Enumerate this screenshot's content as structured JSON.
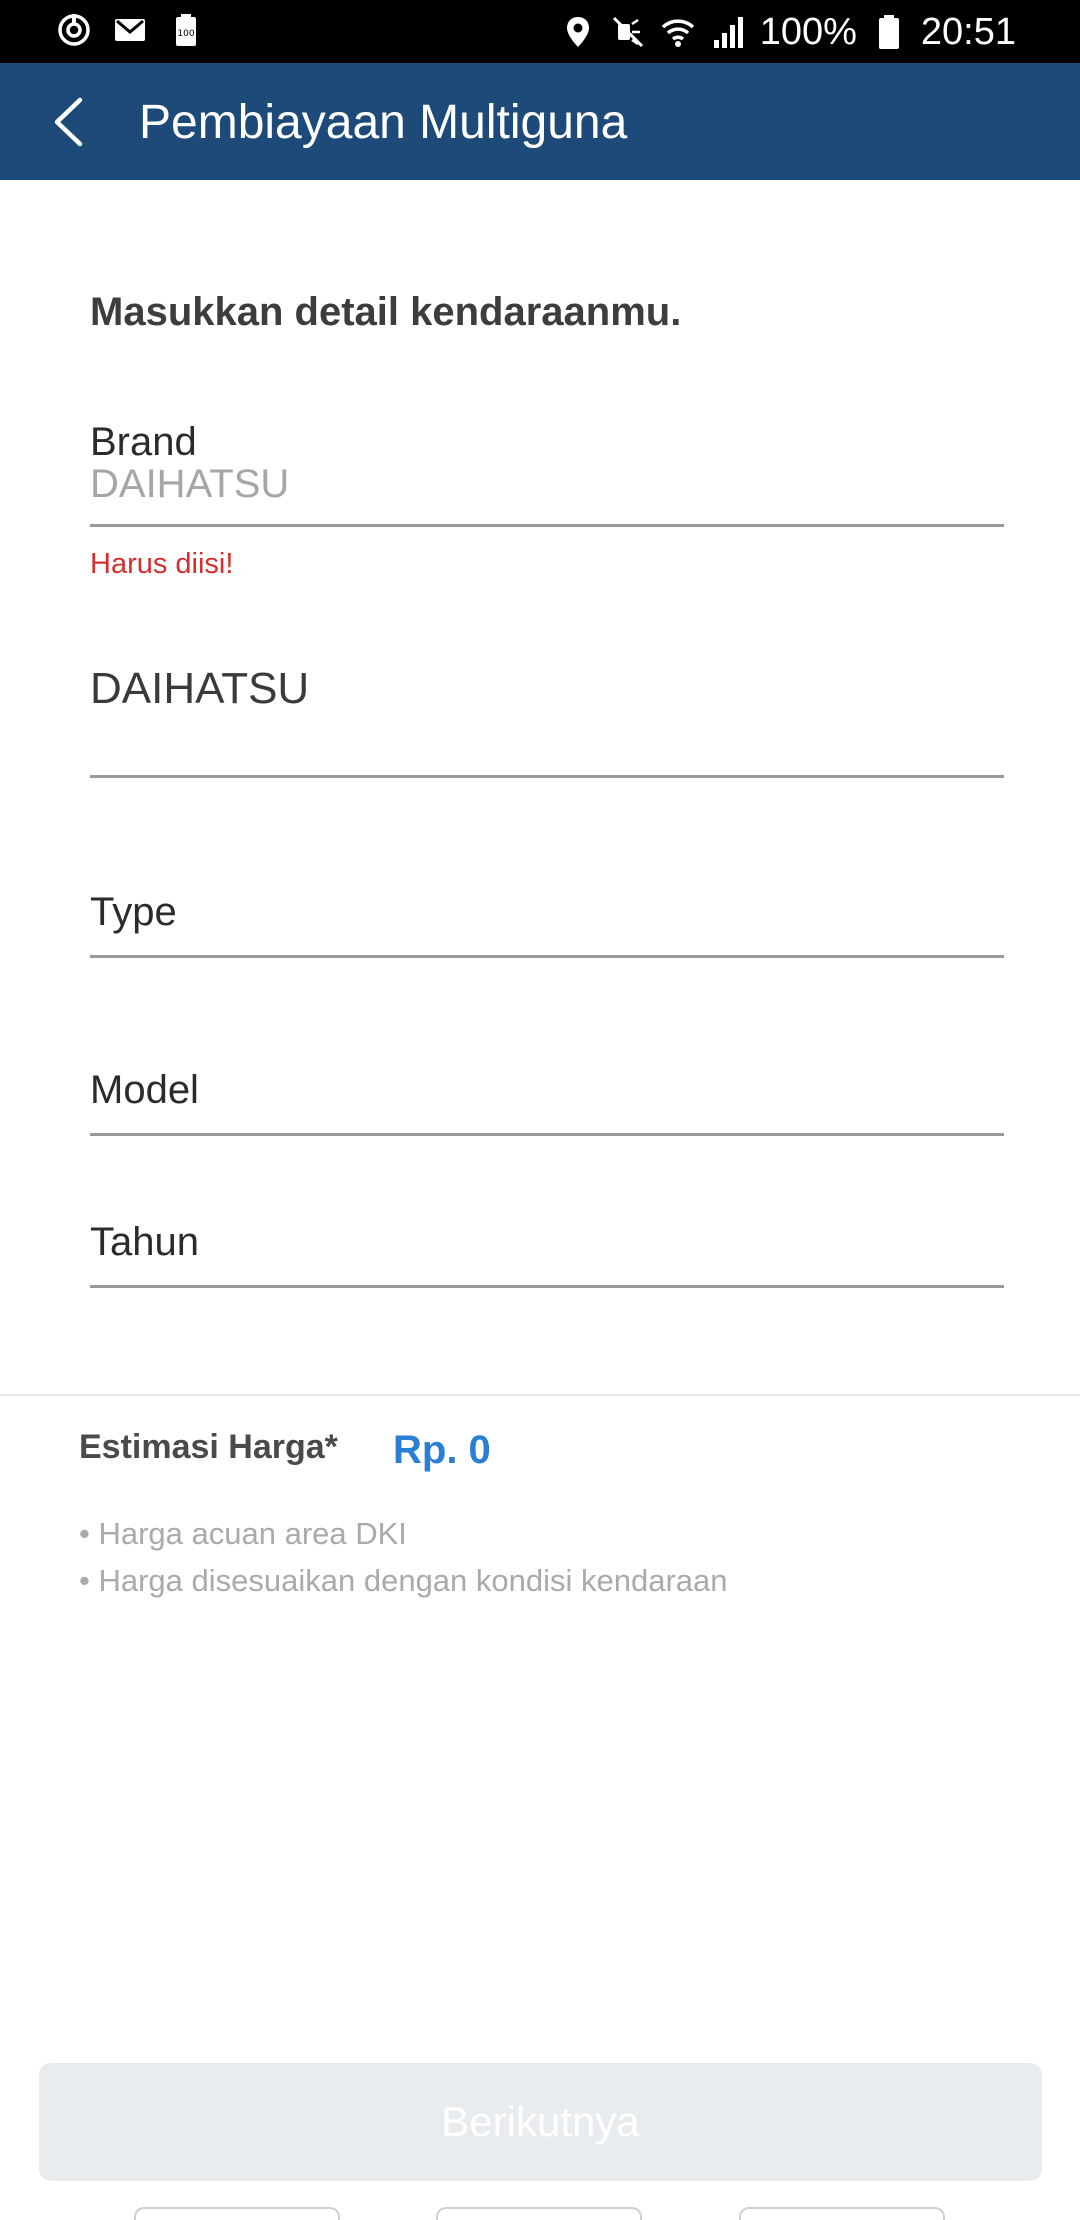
{
  "status_bar": {
    "battery_percent": "100%",
    "time": "20:51",
    "left_icons": [
      "sync-icon",
      "gmail-icon",
      "battery-saver-icon"
    ],
    "right_icons": [
      "location-icon",
      "mute-icon",
      "wifi-icon",
      "signal-icon",
      "battery-icon"
    ]
  },
  "app_bar": {
    "title": "Pembiayaan Multiguna",
    "back_icon": "chevron-left-icon",
    "background": "#1d4a78"
  },
  "form": {
    "heading": "Masukkan detail kendaraanmu.",
    "brand": {
      "label": "Brand",
      "placeholder": "DAIHATSU",
      "error": "Harus diisi!"
    },
    "brand_value": "DAIHATSU",
    "type_label": "Type",
    "model_label": "Model",
    "tahun_label": "Tahun"
  },
  "estimate": {
    "label": "Estimasi Harga*",
    "value": "Rp. 0",
    "value_color": "#2a7fd4",
    "notes": [
      "• Harga acuan area DKI",
      "• Harga disesuaikan dengan kondisi kendaraan"
    ]
  },
  "footer": {
    "next_button": "Berikutnya",
    "error_color": "#d32f2f"
  }
}
